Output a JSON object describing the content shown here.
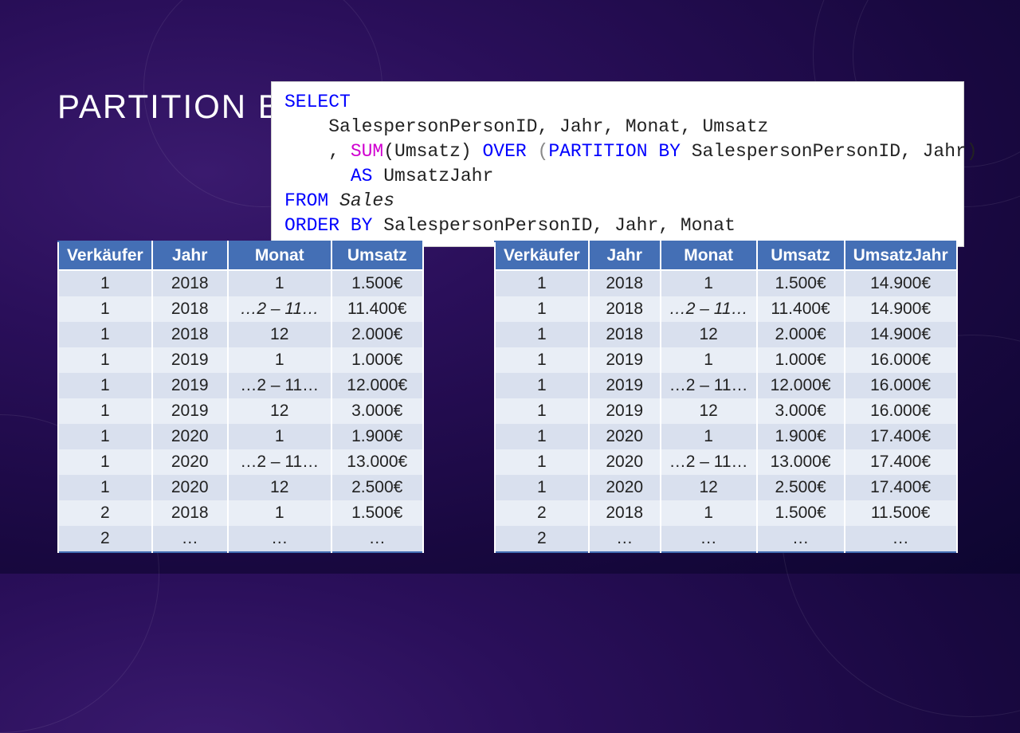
{
  "title": "PARTITION BY",
  "code": {
    "l1a": "SELECT",
    "l2": "    SalespersonPersonID, Jahr, Monat, Umsatz",
    "l3a": "    , ",
    "l3b": "SUM",
    "l3c": "(Umsatz) ",
    "l3d": "OVER",
    "l3e": " (",
    "l3f": "PARTITION BY",
    "l3g": " SalespersonPersonID, Jahr)",
    "l4a": "      ",
    "l4b": "AS",
    "l4c": " UmsatzJahr",
    "l5a": "FROM",
    "l5b": " Sales",
    "l6a": "ORDER BY",
    "l6b": " SalespersonPersonID, Jahr, Monat"
  },
  "table1": {
    "headers": [
      "Verkäufer",
      "Jahr",
      "Monat",
      "Umsatz"
    ],
    "rows": [
      [
        "1",
        "2018",
        "1",
        "1.500€"
      ],
      [
        "1",
        "2018",
        "…2 – 11…",
        "11.400€"
      ],
      [
        "1",
        "2018",
        "12",
        "2.000€"
      ],
      [
        "1",
        "2019",
        "1",
        "1.000€"
      ],
      [
        "1",
        "2019",
        "…2 – 11…",
        "12.000€"
      ],
      [
        "1",
        "2019",
        "12",
        "3.000€"
      ],
      [
        "1",
        "2020",
        "1",
        "1.900€"
      ],
      [
        "1",
        "2020",
        "…2 – 11…",
        "13.000€"
      ],
      [
        "1",
        "2020",
        "12",
        "2.500€"
      ],
      [
        "2",
        "2018",
        "1",
        "1.500€"
      ],
      [
        "2",
        "…",
        "…",
        "…"
      ]
    ]
  },
  "table2": {
    "headers": [
      "Verkäufer",
      "Jahr",
      "Monat",
      "Umsatz",
      "UmsatzJahr"
    ],
    "rows": [
      [
        "1",
        "2018",
        "1",
        "1.500€",
        "14.900€"
      ],
      [
        "1",
        "2018",
        "…2 – 11…",
        "11.400€",
        "14.900€"
      ],
      [
        "1",
        "2018",
        "12",
        "2.000€",
        "14.900€"
      ],
      [
        "1",
        "2019",
        "1",
        "1.000€",
        "16.000€"
      ],
      [
        "1",
        "2019",
        "…2 – 11…",
        "12.000€",
        "16.000€"
      ],
      [
        "1",
        "2019",
        "12",
        "3.000€",
        "16.000€"
      ],
      [
        "1",
        "2020",
        "1",
        "1.900€",
        "17.400€"
      ],
      [
        "1",
        "2020",
        "…2 – 11…",
        "13.000€",
        "17.400€"
      ],
      [
        "1",
        "2020",
        "12",
        "2.500€",
        "17.400€"
      ],
      [
        "2",
        "2018",
        "1",
        "1.500€",
        "11.500€"
      ],
      [
        "2",
        "…",
        "…",
        "…",
        "…"
      ]
    ]
  }
}
